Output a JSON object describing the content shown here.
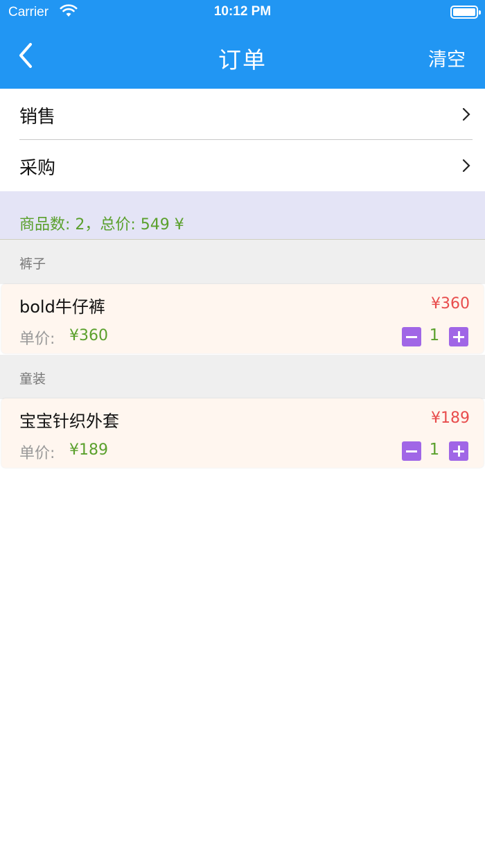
{
  "status_bar": {
    "carrier": "Carrier",
    "time": "10:12 PM"
  },
  "nav": {
    "title": "订单",
    "clear_label": "清空"
  },
  "menu": {
    "sales_label": "销售",
    "purchase_label": "采购"
  },
  "summary": {
    "text": "商品数: 2，总价: 549 ¥"
  },
  "unit_price_label": "单价:",
  "groups": [
    {
      "category": "裤子",
      "item": {
        "name": "bold牛仔裤",
        "total": "¥360",
        "unit_price": "¥360",
        "quantity": "1"
      }
    },
    {
      "category": "童装",
      "item": {
        "name": "宝宝针织外套",
        "total": "¥189",
        "unit_price": "¥189",
        "quantity": "1"
      }
    }
  ],
  "colors": {
    "header": "#2196F3",
    "price_red": "#e84c4c",
    "green": "#5aa02c",
    "stepper": "#a066e6"
  }
}
